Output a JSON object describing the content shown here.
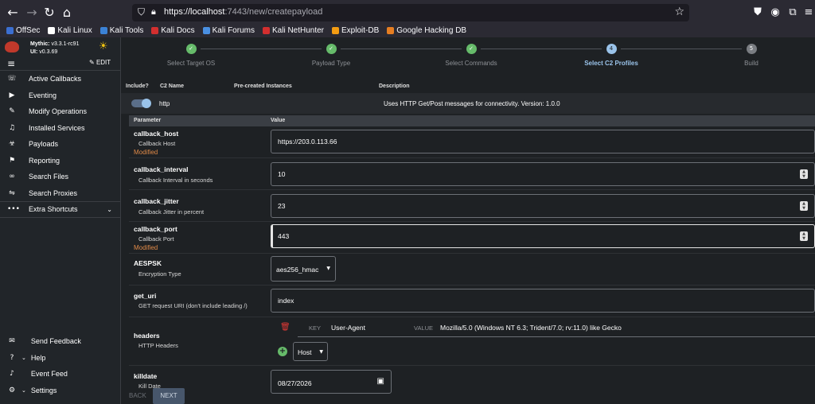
{
  "browser": {
    "url_host": "https://localhost",
    "url_rest": ":7443/new/createpayload",
    "bookmarks": [
      "OffSec",
      "Kali Linux",
      "Kali Tools",
      "Kali Docs",
      "Kali Forums",
      "Kali NetHunter",
      "Exploit-DB",
      "Google Hacking DB"
    ],
    "bookmark_colors": [
      "#3b6fd1",
      "#ffffff",
      "#3b82d6",
      "#d32f2f",
      "#4a90e2",
      "#d32f2f",
      "#f39c12",
      "#e67e22"
    ]
  },
  "sidebar": {
    "version_mythic_label": "Mythic:",
    "version_mythic": "v3.3.1-rc91",
    "version_ui_label": "UI:",
    "version_ui": "v0.3.69",
    "edit_label": "EDIT",
    "items": [
      {
        "label": "Active Callbacks",
        "icon": "phone-callback-icon"
      },
      {
        "label": "Eventing",
        "icon": "play-circle-icon"
      },
      {
        "label": "Modify Operations",
        "icon": "pencil-icon"
      },
      {
        "label": "Installed Services",
        "icon": "headphones-icon"
      },
      {
        "label": "Payloads",
        "icon": "biohazard-icon"
      },
      {
        "label": "Reporting",
        "icon": "flag-icon"
      },
      {
        "label": "Search Files",
        "icon": "attachment-icon"
      },
      {
        "label": "Search Proxies",
        "icon": "proxy-icon"
      }
    ],
    "extra_label": "Extra Shortcuts",
    "bottom_items": [
      {
        "label": "Send Feedback",
        "icon": "feedback-icon"
      },
      {
        "label": "Help",
        "icon": "help-icon"
      },
      {
        "label": "Event Feed",
        "icon": "bell-icon"
      },
      {
        "label": "Settings",
        "icon": "user-settings-icon"
      }
    ]
  },
  "stepper": {
    "steps": [
      {
        "label": "Select Target OS",
        "state": "done",
        "num": "1"
      },
      {
        "label": "Payload Type",
        "state": "done",
        "num": "2"
      },
      {
        "label": "Select Commands",
        "state": "done",
        "num": "3"
      },
      {
        "label": "Select C2 Profiles",
        "state": "active",
        "num": "4"
      },
      {
        "label": "Build",
        "state": "todo",
        "num": "5"
      }
    ]
  },
  "c2_table": {
    "headers": {
      "include": "Include?",
      "name": "C2 Name",
      "instances": "Pre-created Instances",
      "description": "Description"
    },
    "profile": {
      "name": "http",
      "description": "Uses HTTP Get/Post messages for connectivity. Version: 1.0.0",
      "enabled": true
    }
  },
  "params": {
    "headers": {
      "parameter": "Parameter",
      "value": "Value"
    },
    "callback_host": {
      "name": "callback_host",
      "desc": "Callback Host",
      "modified": "Modified",
      "value": "https://203.0.113.66"
    },
    "callback_interval": {
      "name": "callback_interval",
      "desc": "Callback Interval in seconds",
      "value": "10"
    },
    "callback_jitter": {
      "name": "callback_jitter",
      "desc": "Callback Jitter in percent",
      "value": "23"
    },
    "callback_port": {
      "name": "callback_port",
      "desc": "Callback Port",
      "modified": "Modified",
      "value": "443"
    },
    "aespsk": {
      "name": "AESPSK",
      "desc": "Encryption Type",
      "value": "aes256_hmac"
    },
    "get_uri": {
      "name": "get_uri",
      "desc": "GET request URI (don't include leading /)",
      "value": "index"
    },
    "headers_param": {
      "name": "headers",
      "desc": "HTTP Headers",
      "key_label": "KEY",
      "key": "User-Agent",
      "value_label": "VALUE",
      "value": "Mozilla/5.0 (Windows NT 6.3; Trident/7.0; rv:11.0) like Gecko",
      "add_option": "Host"
    },
    "killdate": {
      "name": "killdate",
      "desc": "Kill Date",
      "value": "08/27/2026"
    }
  },
  "footer": {
    "back": "BACK",
    "next": "NEXT"
  }
}
